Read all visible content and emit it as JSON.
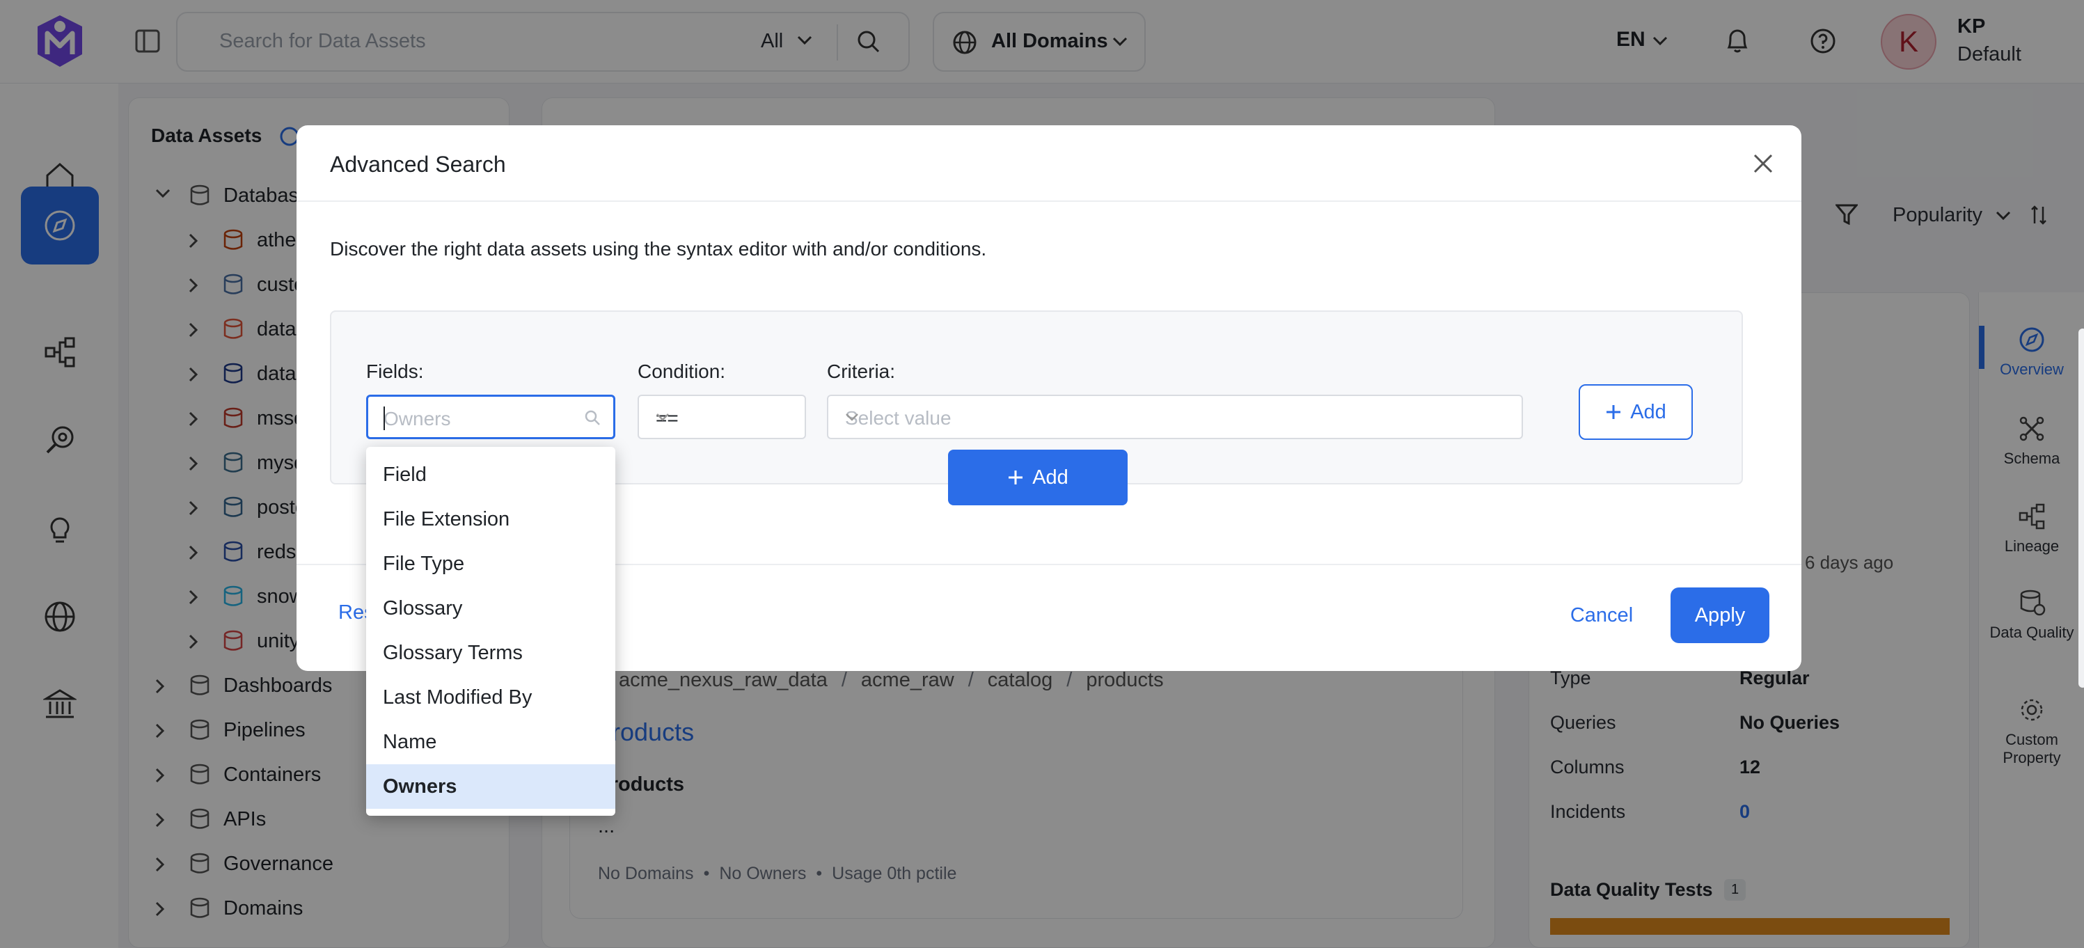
{
  "topbar": {
    "search_placeholder": "Search for Data Assets",
    "search_scope": "All",
    "domain_selector": "All Domains",
    "language": "EN",
    "user_initial": "K",
    "user_name": "KP",
    "user_role": "Default"
  },
  "rail": {
    "items": [
      "home-icon",
      "explore-icon",
      "lineage-icon",
      "observability-icon",
      "insights-icon",
      "domains-icon",
      "governance-icon"
    ],
    "active": "explore-icon"
  },
  "assets_panel": {
    "title": "Data Assets",
    "tree": [
      {
        "label": "Databas",
        "level": 0
      },
      {
        "label": "athen",
        "level": 1
      },
      {
        "label": "custo",
        "level": 1
      },
      {
        "label": "datab",
        "level": 1
      },
      {
        "label": "datal",
        "level": 1
      },
      {
        "label": "mssq",
        "level": 1
      },
      {
        "label": "mysq",
        "level": 1
      },
      {
        "label": "postg",
        "level": 1
      },
      {
        "label": "redsh",
        "level": 1
      },
      {
        "label": "snow",
        "level": 1
      },
      {
        "label": "unity",
        "level": 1
      },
      {
        "label": "Dashboards",
        "level": 0
      },
      {
        "label": "Pipelines",
        "level": 0
      },
      {
        "label": "Containers",
        "level": 0
      },
      {
        "label": "APIs",
        "level": 0
      },
      {
        "label": "Governance",
        "level": 0
      },
      {
        "label": "Domains",
        "level": 0
      }
    ]
  },
  "main": {
    "sort_label": "Popularity",
    "breadcrumb": [
      "acme_nexus_raw_data",
      "acme_raw",
      "catalog",
      "products"
    ],
    "result_title": "products",
    "result_subtitle": "products",
    "result_desc": "...",
    "result_meta": [
      "No Domains",
      "No Owners",
      "Usage 0th pctile"
    ],
    "updated": "6 days ago"
  },
  "details": {
    "rows": [
      {
        "key": "Type",
        "value": "Regular"
      },
      {
        "key": "Queries",
        "value": "No Queries"
      },
      {
        "key": "Columns",
        "value": "12"
      },
      {
        "key": "Incidents",
        "value": "0"
      }
    ],
    "dq_title": "Data Quality Tests",
    "dq_count": "1"
  },
  "right_nav": [
    {
      "label": "Overview",
      "active": true
    },
    {
      "label": "Schema"
    },
    {
      "label": "Lineage"
    },
    {
      "label": "Data Quality"
    },
    {
      "label": "Custom Property"
    }
  ],
  "modal": {
    "title": "Advanced Search",
    "description": "Discover the right data assets using the syntax editor with and/or conditions.",
    "fields_label": "Fields:",
    "fields_placeholder": "Owners",
    "condition_label": "Condition:",
    "condition_value": "==",
    "criteria_label": "Criteria:",
    "criteria_placeholder": "Select value",
    "add_rule_label": "Add",
    "add_group_label": "Add",
    "reset_label": "Res",
    "cancel_label": "Cancel",
    "apply_label": "Apply",
    "dropdown_options": [
      "Field",
      "File Extension",
      "File Type",
      "Glossary",
      "Glossary Terms",
      "Last Modified By",
      "Name",
      "Owners"
    ],
    "selected_option": "Owners"
  },
  "colors": {
    "accent": "#2b6de8",
    "selected_bg": "#dbe8fb",
    "dq_bar": "#e08a1e"
  }
}
